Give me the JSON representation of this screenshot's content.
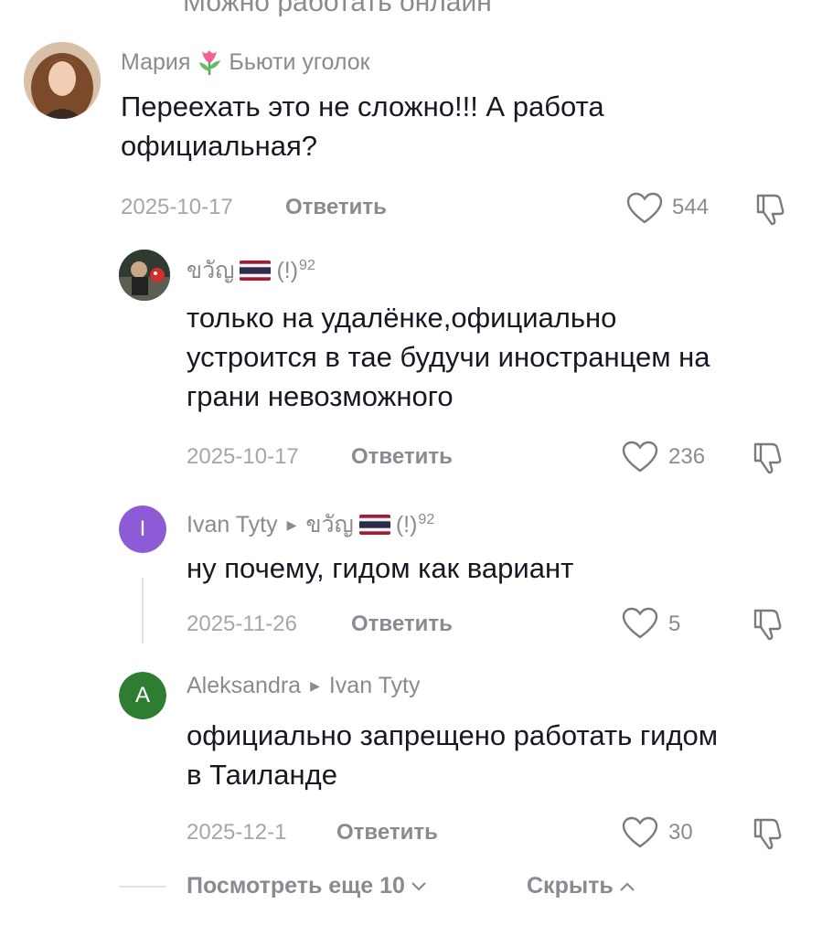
{
  "top_partial_text": "Можно работать онлайн",
  "comments": [
    {
      "username": "Мария",
      "username_suffix": "Бьюти уголок",
      "text_line1": "Переехать это не сложно!!! А работа",
      "text_line2": "официальная?",
      "date": "2025-10-17",
      "reply_label": "Ответить",
      "likes": "544"
    },
    {
      "username": "ขวัญ",
      "username_tail": "(!)",
      "username_sup": "92",
      "text_line1": "только на удалёнке,официально",
      "text_line2": "устроится в тае будучи иностранцем на",
      "text_line3": "грани невозможного",
      "date": "2025-10-17",
      "reply_label": "Ответить",
      "likes": "236"
    },
    {
      "avatar_letter": "I",
      "avatar_color": "#8e5bd6",
      "username": "Ivan Tyty",
      "reply_to": "ขวัญ",
      "reply_to_tail": "(!)",
      "reply_to_sup": "92",
      "text_line1": "ну почему, гидом как вариант",
      "date": "2025-11-26",
      "reply_label": "Ответить",
      "likes": "5"
    },
    {
      "avatar_letter": "A",
      "avatar_color": "#2e7d32",
      "username": "Aleksandra",
      "reply_to": "Ivan Tyty",
      "text_line1": "официально запрещено работать гидом",
      "text_line2": "в Таиланде",
      "date": "2025-12-1",
      "reply_label": "Ответить",
      "likes": "30"
    }
  ],
  "footer": {
    "view_more": "Посмотреть еще 10",
    "hide": "Скрыть"
  }
}
